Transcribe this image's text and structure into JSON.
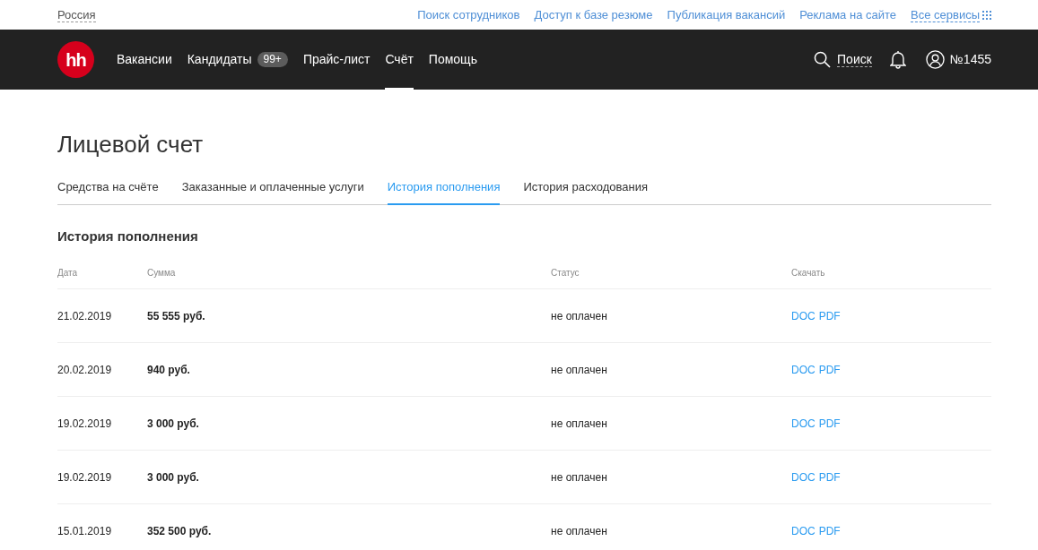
{
  "top_bar": {
    "region": "Россия",
    "links": [
      "Поиск сотрудников",
      "Доступ к базе резюме",
      "Публикация вакансий",
      "Реклама на сайте"
    ],
    "all_services": "Все сервисы"
  },
  "header": {
    "logo": "hh",
    "nav": [
      {
        "label": "Вакансии",
        "selected": false
      },
      {
        "label": "Кандидаты",
        "badge": "99+",
        "selected": false
      },
      {
        "label": "Прайс-лист",
        "selected": false
      },
      {
        "label": "Счёт",
        "selected": true
      },
      {
        "label": "Помощь",
        "selected": false
      }
    ],
    "search": "Поиск",
    "account": "№1455"
  },
  "page": {
    "title": "Лицевой счет",
    "tabs": [
      {
        "label": "Средства на счёте",
        "selected": false
      },
      {
        "label": "Заказанные и оплаченные услуги",
        "selected": false
      },
      {
        "label": "История пополнения",
        "selected": true
      },
      {
        "label": "История расходования",
        "selected": false
      }
    ],
    "section_title": "История пополнения",
    "table": {
      "columns": [
        "Дата",
        "Сумма",
        "Статус",
        "Скачать"
      ],
      "rows": [
        {
          "date": "21.02.2019",
          "amount": "55 555 руб.",
          "status": "не оплачен",
          "downloads": [
            "DOC",
            "PDF"
          ]
        },
        {
          "date": "20.02.2019",
          "amount": "940 руб.",
          "status": "не оплачен",
          "downloads": [
            "DOC",
            "PDF"
          ]
        },
        {
          "date": "19.02.2019",
          "amount": "3 000 руб.",
          "status": "не оплачен",
          "downloads": [
            "DOC",
            "PDF"
          ]
        },
        {
          "date": "19.02.2019",
          "amount": "3 000 руб.",
          "status": "не оплачен",
          "downloads": [
            "DOC",
            "PDF"
          ]
        },
        {
          "date": "15.01.2019",
          "amount": "352 500 руб.",
          "status": "не оплачен",
          "downloads": [
            "DOC",
            "PDF"
          ]
        }
      ]
    }
  }
}
